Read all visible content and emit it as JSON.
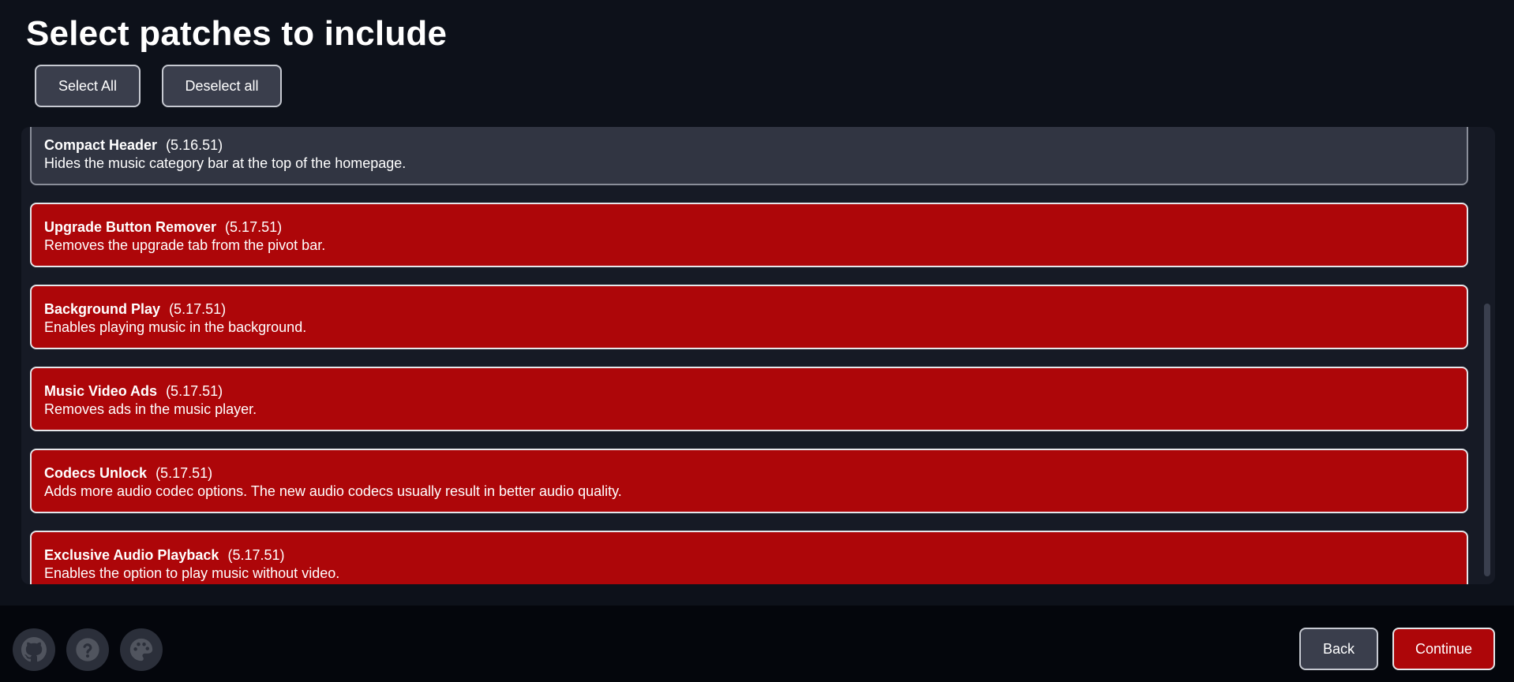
{
  "page": {
    "title": "Select patches to include"
  },
  "toolbar": {
    "select_all_label": "Select All",
    "deselect_all_label": "Deselect all"
  },
  "patches": [
    {
      "name": "Compact Header",
      "version": "(5.16.51)",
      "description": "Hides the music category bar at the top of the homepage.",
      "selected": false
    },
    {
      "name": "Upgrade Button Remover",
      "version": "(5.17.51)",
      "description": "Removes the upgrade tab from the pivot bar.",
      "selected": true
    },
    {
      "name": "Background Play",
      "version": "(5.17.51)",
      "description": "Enables playing music in the background.",
      "selected": true
    },
    {
      "name": "Music Video Ads",
      "version": "(5.17.51)",
      "description": "Removes ads in the music player.",
      "selected": true
    },
    {
      "name": "Codecs Unlock",
      "version": "(5.17.51)",
      "description": "Adds more audio codec options. The new audio codecs usually result in better audio quality.",
      "selected": true
    },
    {
      "name": "Exclusive Audio Playback",
      "version": "(5.17.51)",
      "description": "Enables the option to play music without video.",
      "selected": true
    }
  ],
  "footer": {
    "icons": [
      "github-icon",
      "help-icon",
      "palette-icon"
    ],
    "back_label": "Back",
    "continue_label": "Continue"
  },
  "colors": {
    "background": "#0d111a",
    "panel": "#161a25",
    "selected_patch": "#ad0609",
    "unselected_patch": "#313542",
    "button": "#3a3e4c",
    "footer": "#04060c"
  }
}
